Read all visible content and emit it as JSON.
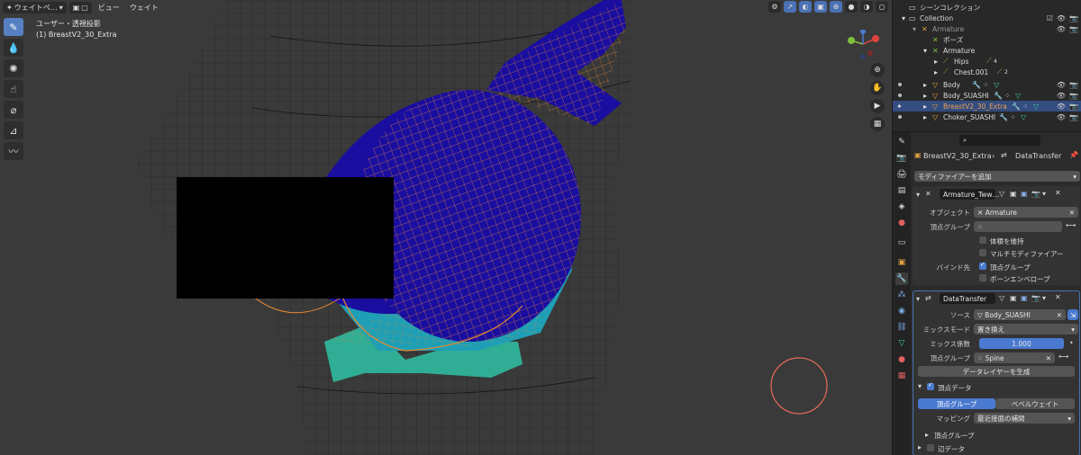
{
  "viewport": {
    "header": {
      "mode_label": "ウェイトペ…",
      "view_menu": "ビュー",
      "weight_menu": "ウェイト"
    },
    "info": {
      "line1": "ユーザー・透視投影",
      "line2": "(1) BreastV2_30_Extra"
    }
  },
  "outliner": {
    "title": "シーンコレクション",
    "rows": [
      {
        "label": "Collection"
      },
      {
        "label": "Armature"
      },
      {
        "label": "ポーズ"
      },
      {
        "label": "Armature"
      },
      {
        "label": "Hips"
      },
      {
        "label": "Chest.001"
      },
      {
        "label": "Body"
      },
      {
        "label": "Body_SUASHI"
      },
      {
        "label": "BreastV2_30_Extra"
      },
      {
        "label": "Choker_SUASHI"
      }
    ],
    "hips_badge": "4",
    "chest_badge": "2"
  },
  "properties": {
    "breadcrumb_object": "BreastV2_30_Extra",
    "breadcrumb_modifier": "DataTransfer",
    "add_modifier": "モディファイアーを追加",
    "armature_modifier": {
      "name": "Armature_Tww…",
      "object_label": "オブジェクト",
      "object_value": "Armature",
      "vgroup_label": "頂点グループ",
      "preserve_volume": "体積を維持",
      "multi_modifier": "マルチモディファイアー",
      "bind_to_label": "バインド先",
      "bind_vgroups": "頂点グループ",
      "bind_envelopes": "ボーンエンベロープ"
    },
    "datatransfer_modifier": {
      "name": "DataTransfer",
      "source_label": "ソース",
      "source_value": "Body_SUASHI",
      "mix_mode_label": "ミックスモード",
      "mix_mode_value": "置き換え",
      "mix_factor_label": "ミックス係数",
      "mix_factor_value": "1.000",
      "vgroup_label": "頂点グループ",
      "vgroup_value": "Spine",
      "generate_layers": "データレイヤーを生成",
      "vertex_data": "頂点データ",
      "tab_vgroups": "頂点グループ",
      "tab_bevel": "ベベルウェイト",
      "mapping_label": "マッピング",
      "mapping_value": "最近接面の補間",
      "sub_vgroups": "頂点グループ",
      "edge_data": "辺データ"
    }
  },
  "colors": {
    "accent": "#4a7ad0",
    "selected_row": "#334d80",
    "mesh_blue": "#1a0ea0",
    "mesh_teal": "#2fb39a",
    "wire_orange": "#e88a2e"
  }
}
